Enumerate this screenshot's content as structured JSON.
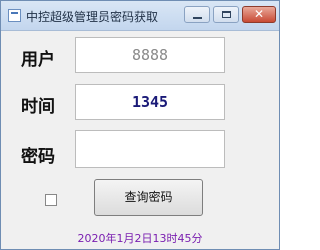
{
  "window": {
    "title": "中控超级管理员密码获取",
    "minimize_icon": "minimize-icon",
    "maximize_icon": "maximize-icon",
    "close_icon": "close-icon",
    "close_glyph": "✕"
  },
  "form": {
    "user_label": "用户",
    "user_value": "8888",
    "time_label": "时间",
    "time_value": "1345",
    "password_label": "密码",
    "password_value": ""
  },
  "actions": {
    "checkbox_checked": false,
    "query_button_label": "查询密码"
  },
  "status": {
    "datetime": "2020年1月2日13时45分"
  },
  "colors": {
    "time_value": "#1a1a78",
    "user_value": "#8a8a8a",
    "datetime_text": "#7a1fb0"
  }
}
